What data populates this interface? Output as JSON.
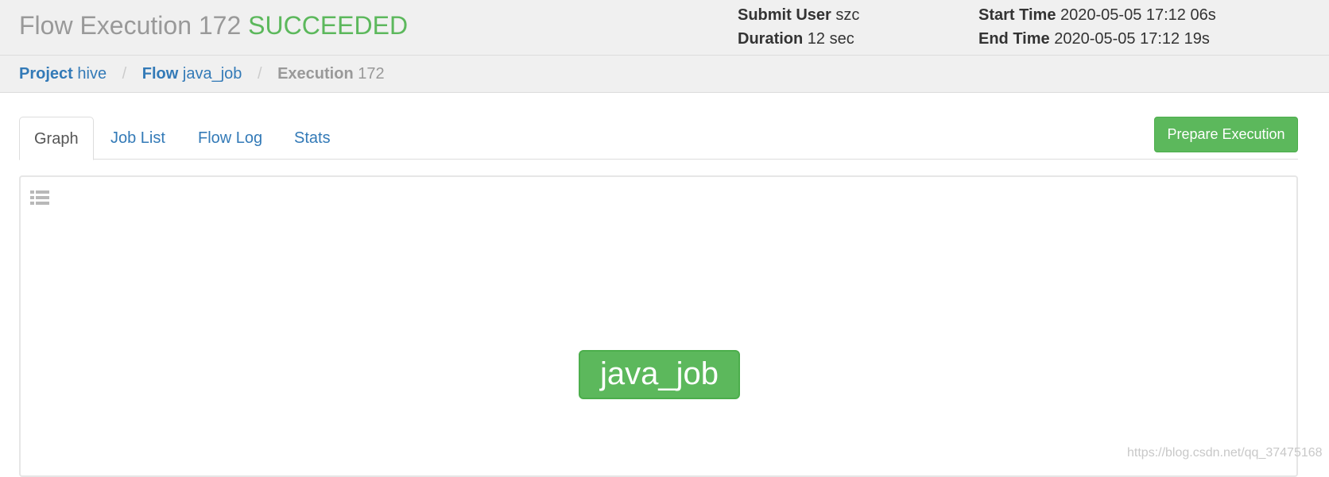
{
  "header": {
    "title_prefix": "Flow Execution 172",
    "status": "SUCCEEDED",
    "colors": {
      "status": "#5cb85c",
      "title": "#999999"
    },
    "submit_user_label": "Submit User",
    "submit_user": "szc",
    "duration_label": "Duration",
    "duration": "12 sec",
    "start_time_label": "Start Time",
    "start_time": "2020-05-05 17:12 06s",
    "end_time_label": "End Time",
    "end_time": "2020-05-05 17:12 19s"
  },
  "breadcrumb": {
    "separator": "/",
    "project_key": "Project",
    "project_value": "hive",
    "flow_key": "Flow",
    "flow_value": "java_job",
    "execution_key": "Execution",
    "execution_value": "172"
  },
  "tabs": [
    {
      "label": "Graph",
      "active": true
    },
    {
      "label": "Job List",
      "active": false
    },
    {
      "label": "Flow Log",
      "active": false
    },
    {
      "label": "Stats",
      "active": false
    }
  ],
  "actions": {
    "prepare_execution_label": "Prepare Execution",
    "color": "#5cb85c"
  },
  "graph": {
    "toggle_icon": "list-icon",
    "nodes": [
      {
        "label": "java_job",
        "status": "succeeded",
        "color": "#5cb85c"
      }
    ]
  },
  "watermark": "https://blog.csdn.net/qq_37475168"
}
